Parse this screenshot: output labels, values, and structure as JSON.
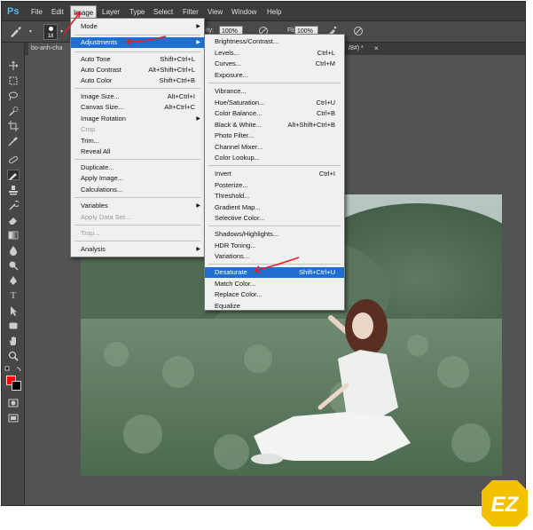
{
  "menubar": {
    "logo": "Ps",
    "items": [
      "File",
      "Edit",
      "Image",
      "Layer",
      "Type",
      "Select",
      "Filter",
      "View",
      "Window",
      "Help"
    ]
  },
  "options": {
    "brush_size": "18",
    "opacity_label": "ity:",
    "opacity_value": "100%",
    "flow_label": "Flow:",
    "flow_value": "100%"
  },
  "tabs": {
    "doc_tab": "bo-anh-cha",
    "doc_tab_right": "/8#) *"
  },
  "image_menu": {
    "items": [
      {
        "label": "Mode",
        "shortcut": "",
        "submenu": true,
        "disabled": false
      },
      {
        "label": "Adjustments",
        "shortcut": "",
        "submenu": true,
        "disabled": false,
        "highlighted": true
      },
      {
        "label": "Auto Tone",
        "shortcut": "Shift+Ctrl+L",
        "submenu": false,
        "disabled": false
      },
      {
        "label": "Auto Contrast",
        "shortcut": "Alt+Shift+Ctrl+L",
        "submenu": false,
        "disabled": false
      },
      {
        "label": "Auto Color",
        "shortcut": "Shift+Ctrl+B",
        "submenu": false,
        "disabled": false
      },
      {
        "label": "Image Size...",
        "shortcut": "Alt+Ctrl+I",
        "submenu": false,
        "disabled": false
      },
      {
        "label": "Canvas Size...",
        "shortcut": "Alt+Ctrl+C",
        "submenu": false,
        "disabled": false
      },
      {
        "label": "Image Rotation",
        "shortcut": "",
        "submenu": true,
        "disabled": false
      },
      {
        "label": "Crop",
        "shortcut": "",
        "submenu": false,
        "disabled": true
      },
      {
        "label": "Trim...",
        "shortcut": "",
        "submenu": false,
        "disabled": false
      },
      {
        "label": "Reveal All",
        "shortcut": "",
        "submenu": false,
        "disabled": false
      },
      {
        "label": "Duplicate...",
        "shortcut": "",
        "submenu": false,
        "disabled": false
      },
      {
        "label": "Apply Image...",
        "shortcut": "",
        "submenu": false,
        "disabled": false
      },
      {
        "label": "Calculations...",
        "shortcut": "",
        "submenu": false,
        "disabled": false
      },
      {
        "label": "Variables",
        "shortcut": "",
        "submenu": true,
        "disabled": false
      },
      {
        "label": "Apply Data Set...",
        "shortcut": "",
        "submenu": false,
        "disabled": true
      },
      {
        "label": "Trap...",
        "shortcut": "",
        "submenu": false,
        "disabled": true
      },
      {
        "label": "Analysis",
        "shortcut": "",
        "submenu": true,
        "disabled": false
      }
    ]
  },
  "adjustments_menu": {
    "items": [
      {
        "label": "Brightness/Contrast...",
        "shortcut": ""
      },
      {
        "label": "Levels...",
        "shortcut": "Ctrl+L"
      },
      {
        "label": "Curves...",
        "shortcut": "Ctrl+M"
      },
      {
        "label": "Exposure...",
        "shortcut": ""
      },
      {
        "label": "Vibrance...",
        "shortcut": ""
      },
      {
        "label": "Hue/Saturation...",
        "shortcut": "Ctrl+U"
      },
      {
        "label": "Color Balance...",
        "shortcut": "Ctrl+B"
      },
      {
        "label": "Black & White...",
        "shortcut": "Alt+Shift+Ctrl+B"
      },
      {
        "label": "Photo Filter...",
        "shortcut": ""
      },
      {
        "label": "Channel Mixer...",
        "shortcut": ""
      },
      {
        "label": "Color Lookup...",
        "shortcut": ""
      },
      {
        "label": "Invert",
        "shortcut": "Ctrl+I"
      },
      {
        "label": "Posterize...",
        "shortcut": ""
      },
      {
        "label": "Threshold...",
        "shortcut": ""
      },
      {
        "label": "Gradient Map...",
        "shortcut": ""
      },
      {
        "label": "Selective Color...",
        "shortcut": ""
      },
      {
        "label": "Shadows/Highlights...",
        "shortcut": ""
      },
      {
        "label": "HDR Toning...",
        "shortcut": ""
      },
      {
        "label": "Variations...",
        "shortcut": ""
      },
      {
        "label": "Desaturate",
        "shortcut": "Shift+Ctrl+U",
        "highlighted": true
      },
      {
        "label": "Match Color...",
        "shortcut": ""
      },
      {
        "label": "Replace Color...",
        "shortcut": ""
      },
      {
        "label": "Equalize",
        "shortcut": ""
      }
    ]
  },
  "watermark": {
    "text": "EZ"
  },
  "colors": {
    "foreground": "#ff0000",
    "background": "#000000",
    "highlight": "#1f6fd1",
    "annotation_arrow": "#e0202a",
    "watermark": "#f2c200"
  }
}
